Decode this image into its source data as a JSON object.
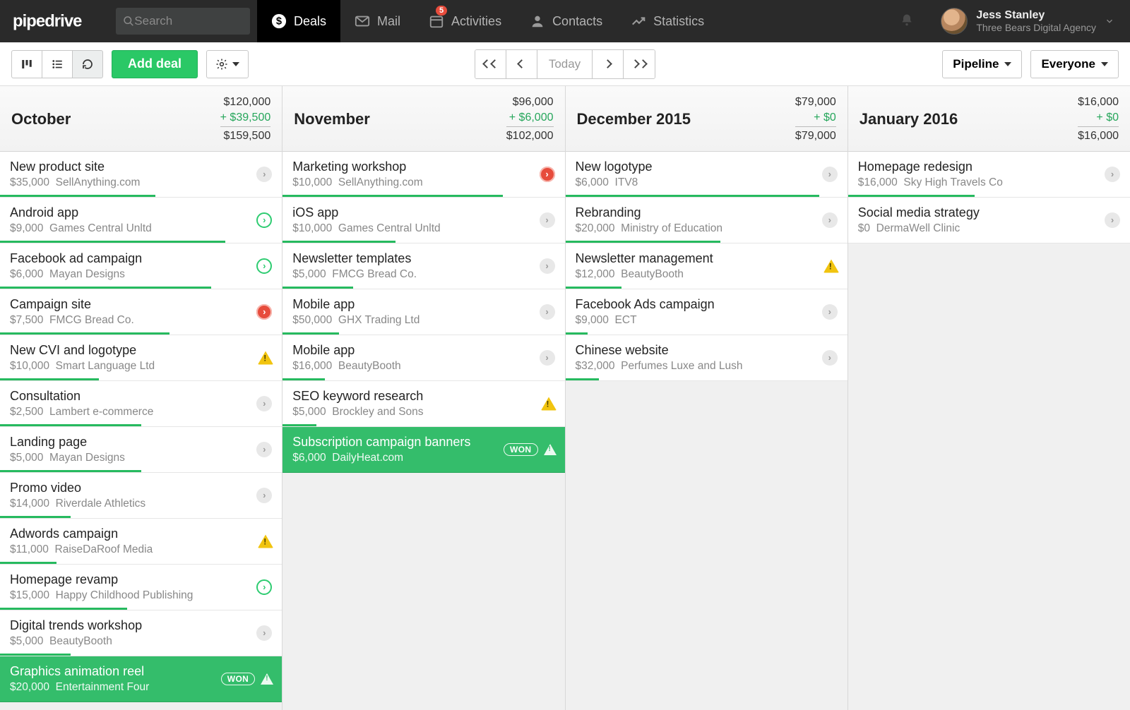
{
  "brand": "pipedrive",
  "search": {
    "placeholder": "Search"
  },
  "nav": {
    "deals": "Deals",
    "mail": "Mail",
    "activities": "Activities",
    "activities_badge": "5",
    "contacts": "Contacts",
    "statistics": "Statistics"
  },
  "user": {
    "name": "Jess Stanley",
    "org": "Three Bears Digital Agency"
  },
  "toolbar": {
    "add_deal": "Add deal",
    "today": "Today",
    "pipeline": "Pipeline",
    "everyone": "Everyone"
  },
  "won_label": "WON",
  "columns": [
    {
      "title": "October",
      "sums": {
        "top": "$120,000",
        "delta": "+ $39,500",
        "total": "$159,500"
      },
      "cards": [
        {
          "title": "New product site",
          "amount": "$35,000",
          "org": "SellAnything.com",
          "status": "neutral",
          "progress": 55
        },
        {
          "title": "Android app",
          "amount": "$9,000",
          "org": "Games Central Unltd",
          "status": "green",
          "progress": 80
        },
        {
          "title": "Facebook ad campaign",
          "amount": "$6,000",
          "org": "Mayan Designs",
          "status": "green",
          "progress": 75
        },
        {
          "title": "Campaign site",
          "amount": "$7,500",
          "org": "FMCG Bread Co.",
          "status": "red",
          "progress": 60
        },
        {
          "title": "New CVI and logotype",
          "amount": "$10,000",
          "org": "Smart Language Ltd",
          "status": "warn",
          "progress": 35
        },
        {
          "title": "Consultation",
          "amount": "$2,500",
          "org": "Lambert e-commerce",
          "status": "neutral",
          "progress": 50
        },
        {
          "title": "Landing page",
          "amount": "$5,000",
          "org": "Mayan Designs",
          "status": "neutral",
          "progress": 50
        },
        {
          "title": "Promo video",
          "amount": "$14,000",
          "org": "Riverdale Athletics",
          "status": "neutral",
          "progress": 25
        },
        {
          "title": "Adwords campaign",
          "amount": "$11,000",
          "org": "RaiseDaRoof Media",
          "status": "warn",
          "progress": 20
        },
        {
          "title": "Homepage revamp",
          "amount": "$15,000",
          "org": "Happy Childhood Publishing",
          "status": "green",
          "progress": 45
        },
        {
          "title": "Digital trends workshop",
          "amount": "$5,000",
          "org": "BeautyBooth",
          "status": "neutral",
          "progress": 25
        },
        {
          "title": "Graphics animation reel",
          "amount": "$20,000",
          "org": "Entertainment Four",
          "status": "won",
          "won": true,
          "progress": 100
        }
      ]
    },
    {
      "title": "November",
      "sums": {
        "top": "$96,000",
        "delta": "+ $6,000",
        "total": "$102,000"
      },
      "cards": [
        {
          "title": "Marketing workshop",
          "amount": "$10,000",
          "org": "SellAnything.com",
          "status": "red",
          "progress": 78
        },
        {
          "title": "iOS app",
          "amount": "$10,000",
          "org": "Games Central Unltd",
          "status": "neutral",
          "progress": 40
        },
        {
          "title": "Newsletter templates",
          "amount": "$5,000",
          "org": "FMCG Bread Co.",
          "status": "neutral",
          "progress": 25
        },
        {
          "title": "Mobile app",
          "amount": "$50,000",
          "org": "GHX Trading Ltd",
          "status": "neutral",
          "progress": 20
        },
        {
          "title": "Mobile app",
          "amount": "$16,000",
          "org": "BeautyBooth",
          "status": "neutral",
          "progress": 15
        },
        {
          "title": "SEO keyword research",
          "amount": "$5,000",
          "org": "Brockley and Sons",
          "status": "warn",
          "progress": 12
        },
        {
          "title": "Subscription campaign banners",
          "amount": "$6,000",
          "org": "DailyHeat.com",
          "status": "won",
          "won": true,
          "progress": 100
        }
      ]
    },
    {
      "title": "December 2015",
      "sums": {
        "top": "$79,000",
        "delta": "+ $0",
        "total": "$79,000"
      },
      "cards": [
        {
          "title": "New logotype",
          "amount": "$6,000",
          "org": "ITV8",
          "status": "neutral",
          "progress": 90
        },
        {
          "title": "Rebranding",
          "amount": "$20,000",
          "org": "Ministry of Education",
          "status": "neutral",
          "progress": 55
        },
        {
          "title": "Newsletter management",
          "amount": "$12,000",
          "org": "BeautyBooth",
          "status": "warn",
          "progress": 20
        },
        {
          "title": "Facebook Ads campaign",
          "amount": "$9,000",
          "org": "ECT",
          "status": "neutral",
          "progress": 8
        },
        {
          "title": "Chinese website",
          "amount": "$32,000",
          "org": "Perfumes Luxe and Lush",
          "status": "neutral",
          "progress": 12
        }
      ]
    },
    {
      "title": "January 2016",
      "sums": {
        "top": "$16,000",
        "delta": "+ $0",
        "total": "$16,000"
      },
      "cards": [
        {
          "title": "Homepage redesign",
          "amount": "$16,000",
          "org": "Sky High Travels Co",
          "status": "neutral",
          "progress": 45
        },
        {
          "title": "Social media strategy",
          "amount": "$0",
          "org": "DermaWell Clinic",
          "status": "neutral",
          "progress": 0
        }
      ]
    }
  ]
}
